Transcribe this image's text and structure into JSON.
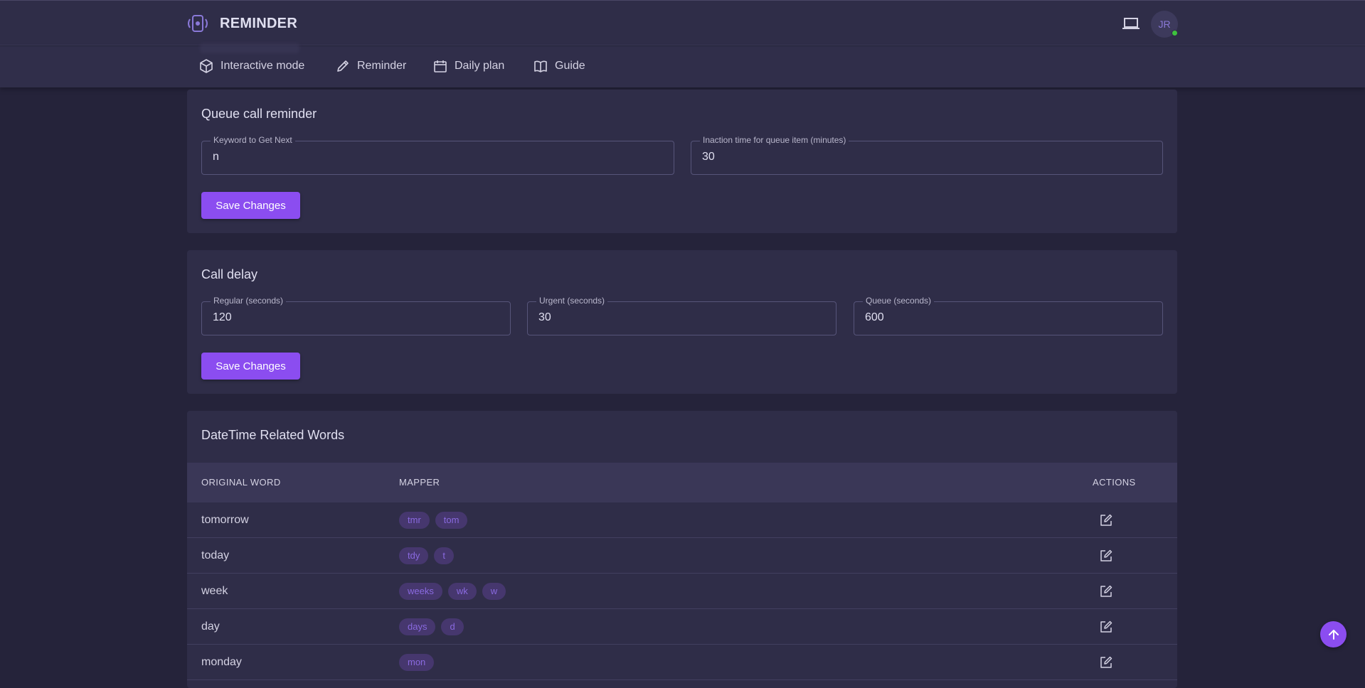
{
  "app": {
    "title": "REMINDER",
    "avatar_initials": "JR",
    "accent_color": "#8b4df0"
  },
  "nav": [
    {
      "label": "Interactive mode",
      "icon": "cube-icon"
    },
    {
      "label": "Reminder",
      "icon": "pencil-icon"
    },
    {
      "label": "Daily plan",
      "icon": "calendar-icon"
    },
    {
      "label": "Guide",
      "icon": "book-icon"
    }
  ],
  "queue_reminder": {
    "title": "Queue call reminder",
    "keyword_label": "Keyword to Get Next",
    "keyword_value": "n",
    "inaction_label": "Inaction time for queue item (minutes)",
    "inaction_value": "30",
    "save_label": "Save Changes"
  },
  "call_delay": {
    "title": "Call delay",
    "regular_label": "Regular (seconds)",
    "regular_value": "120",
    "urgent_label": "Urgent (seconds)",
    "urgent_value": "30",
    "queue_label": "Queue (seconds)",
    "queue_value": "600",
    "save_label": "Save Changes"
  },
  "datetime_words": {
    "title": "DateTime Related Words",
    "columns": [
      "ORIGINAL WORD",
      "MAPPER",
      "ACTIONS"
    ],
    "rows": [
      {
        "word": "tomorrow",
        "mappers": [
          "tmr",
          "tom"
        ]
      },
      {
        "word": "today",
        "mappers": [
          "tdy",
          "t"
        ]
      },
      {
        "word": "week",
        "mappers": [
          "weeks",
          "wk",
          "w"
        ]
      },
      {
        "word": "day",
        "mappers": [
          "days",
          "d"
        ]
      },
      {
        "word": "monday",
        "mappers": [
          "mon"
        ]
      }
    ]
  }
}
